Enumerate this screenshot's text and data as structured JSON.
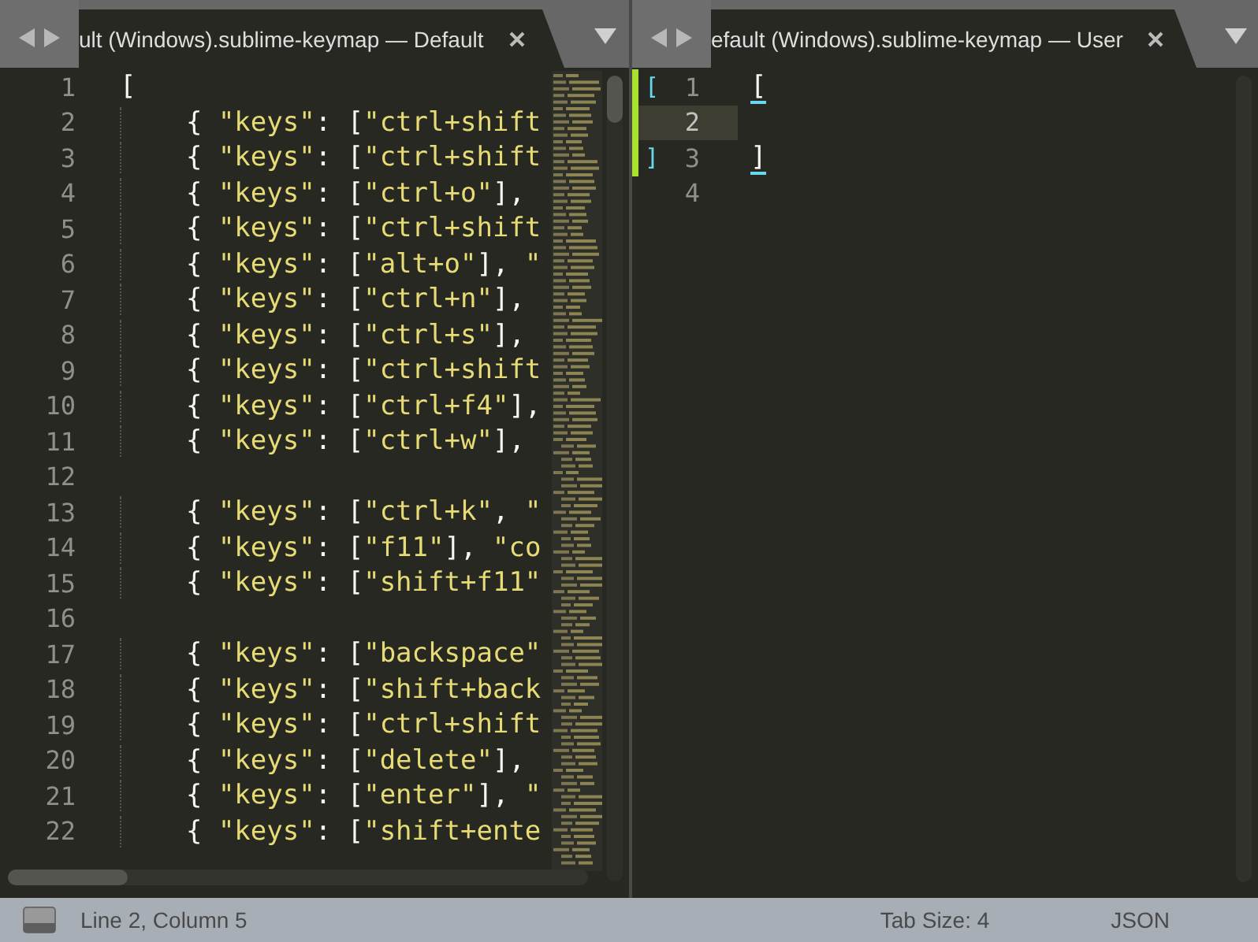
{
  "panes": [
    {
      "tab": {
        "title": "ult (Windows).sublime-keymap — Default",
        "selected": true
      },
      "minimap": true,
      "lines": [
        {
          "number": "1",
          "code": "[",
          "current": false,
          "modified": false
        },
        {
          "number": "2",
          "code": "    { \"keys\": [\"ctrl+shift",
          "current": false,
          "modified": false
        },
        {
          "number": "3",
          "code": "    { \"keys\": [\"ctrl+shift",
          "current": false,
          "modified": false
        },
        {
          "number": "4",
          "code": "    { \"keys\": [\"ctrl+o\"],",
          "current": false,
          "modified": false
        },
        {
          "number": "5",
          "code": "    { \"keys\": [\"ctrl+shift",
          "current": false,
          "modified": false
        },
        {
          "number": "6",
          "code": "    { \"keys\": [\"alt+o\"], \"",
          "current": false,
          "modified": false
        },
        {
          "number": "7",
          "code": "    { \"keys\": [\"ctrl+n\"],",
          "current": false,
          "modified": false
        },
        {
          "number": "8",
          "code": "    { \"keys\": [\"ctrl+s\"],",
          "current": false,
          "modified": false
        },
        {
          "number": "9",
          "code": "    { \"keys\": [\"ctrl+shift",
          "current": false,
          "modified": false
        },
        {
          "number": "10",
          "code": "    { \"keys\": [\"ctrl+f4\"],",
          "current": false,
          "modified": false
        },
        {
          "number": "11",
          "code": "    { \"keys\": [\"ctrl+w\"],",
          "current": false,
          "modified": false
        },
        {
          "number": "12",
          "current": false,
          "modified": false
        },
        {
          "number": "13",
          "code": "    { \"keys\": [\"ctrl+k\", \"",
          "current": false,
          "modified": false
        },
        {
          "number": "14",
          "code": "    { \"keys\": [\"f11\"], \"co",
          "current": false,
          "modified": false
        },
        {
          "number": "15",
          "code": "    { \"keys\": [\"shift+f11\"",
          "current": false,
          "modified": false
        },
        {
          "number": "16",
          "current": false,
          "modified": false
        },
        {
          "number": "17",
          "code": "    { \"keys\": [\"backspace\"",
          "current": false,
          "modified": false
        },
        {
          "number": "18",
          "code": "    { \"keys\": [\"shift+back",
          "current": false,
          "modified": false
        },
        {
          "number": "19",
          "code": "    { \"keys\": [\"ctrl+shift",
          "current": false,
          "modified": false
        },
        {
          "number": "20",
          "code": "    { \"keys\": [\"delete\"],",
          "current": false,
          "modified": false
        },
        {
          "number": "21",
          "code": "    { \"keys\": [\"enter\"], \"",
          "current": false,
          "modified": false
        },
        {
          "number": "22",
          "code": "    { \"keys\": [\"shift+ente",
          "current": false,
          "modified": false
        }
      ]
    },
    {
      "tab": {
        "title": "efault (Windows).sublime-keymap — User",
        "selected": true
      },
      "minimap": false,
      "lines": [
        {
          "number": "1",
          "code": "[",
          "gutter_mark": "[",
          "current": false,
          "modified": true,
          "bracket_match": true
        },
        {
          "number": "2",
          "current": true,
          "modified": true
        },
        {
          "number": "3",
          "code": "]",
          "gutter_mark": "]",
          "current": false,
          "modified": true,
          "bracket_match": true
        },
        {
          "number": "4",
          "current": false,
          "modified": false
        }
      ]
    }
  ],
  "status_bar": {
    "position": "Line 2, Column 5",
    "tab_size": "Tab Size: 4",
    "syntax": "JSON"
  }
}
